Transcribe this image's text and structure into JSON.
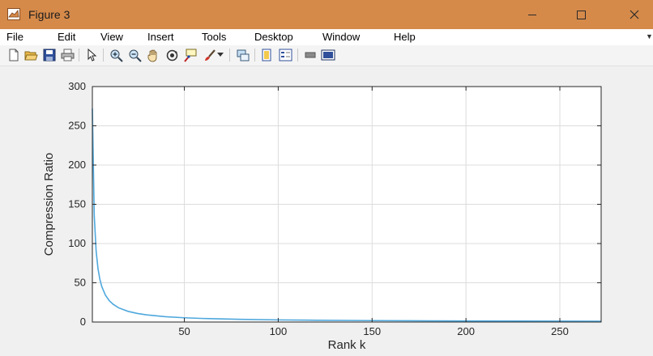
{
  "window": {
    "title": "Figure 3"
  },
  "menu": {
    "items": [
      "File",
      "Edit",
      "View",
      "Insert",
      "Tools",
      "Desktop",
      "Window",
      "Help"
    ]
  },
  "toolbar": {
    "icons": [
      "new-figure-icon",
      "open-file-icon",
      "save-icon",
      "print-icon",
      "edit-plot-arrow-icon",
      "zoom-in-icon",
      "zoom-out-icon",
      "pan-hand-icon",
      "rotate-3d-icon",
      "data-cursor-icon",
      "brush-icon",
      "brush-dropdown-icon",
      "link-plot-icon",
      "insert-colorbar-icon",
      "insert-legend-icon",
      "hide-plot-tools-icon",
      "show-plot-tools-icon"
    ]
  },
  "colors": {
    "titlebar": "#d58a4a",
    "line": "#4fa8dd",
    "axes_bg": "#ffffff",
    "figure_bg": "#f0f0f0"
  },
  "chart_data": {
    "type": "line",
    "title": "",
    "xlabel": "Rank k",
    "ylabel": "Compression Ratio",
    "xlim": [
      1,
      272
    ],
    "ylim": [
      0,
      300
    ],
    "xticks": [
      50,
      100,
      150,
      200,
      250
    ],
    "yticks": [
      0,
      50,
      100,
      150,
      200,
      250,
      300
    ],
    "grid": true,
    "series": [
      {
        "name": "",
        "x": [
          1,
          2,
          3,
          4,
          5,
          6,
          8,
          10,
          12,
          15,
          20,
          25,
          30,
          40,
          50,
          60,
          80,
          100,
          120,
          150,
          180,
          200,
          230,
          250,
          272
        ],
        "y": [
          272,
          136,
          90.7,
          68,
          54.4,
          45.3,
          34,
          27.2,
          22.7,
          18.1,
          13.6,
          10.9,
          9.1,
          6.8,
          5.4,
          4.5,
          3.4,
          2.7,
          2.3,
          1.8,
          1.5,
          1.4,
          1.2,
          1.1,
          1.0
        ]
      }
    ]
  }
}
